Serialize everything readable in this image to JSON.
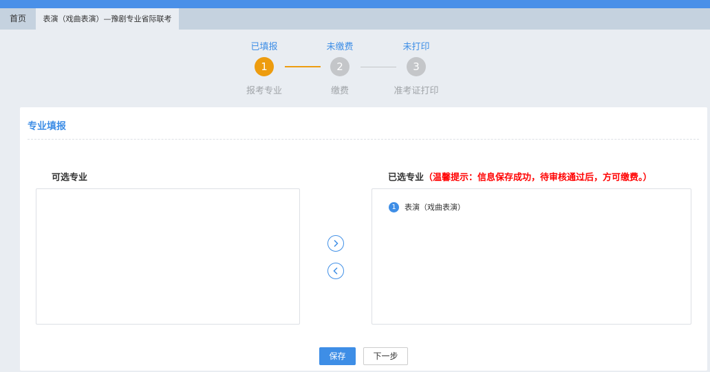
{
  "tabs": {
    "home": "首页",
    "exam": "表演（戏曲表演）—豫剧专业省际联考"
  },
  "steps": [
    {
      "status": "已填报",
      "number": "1",
      "label": "报考专业",
      "state": "active"
    },
    {
      "status": "未缴费",
      "number": "2",
      "label": "缴费",
      "state": "inactive"
    },
    {
      "status": "未打印",
      "number": "3",
      "label": "准考证打印",
      "state": "inactive"
    }
  ],
  "panel": {
    "title": "专业填报",
    "available_label": "可选专业",
    "selected_label": "已选专业",
    "hint": "（温馨提示：信息保存成功，待审核通过后，方可缴费。）",
    "selected_items": [
      {
        "number": "1",
        "name": "表演（戏曲表演）"
      }
    ]
  },
  "buttons": {
    "save": "保存",
    "next": "下一步"
  },
  "colors": {
    "accent": "#3e8ee6",
    "active_step": "#ed9c0f",
    "inactive_step": "#c4c6c9",
    "hint": "#ff0000"
  },
  "icons": {
    "move_right": "chevron-right-circle-icon",
    "move_left": "chevron-left-circle-icon"
  }
}
